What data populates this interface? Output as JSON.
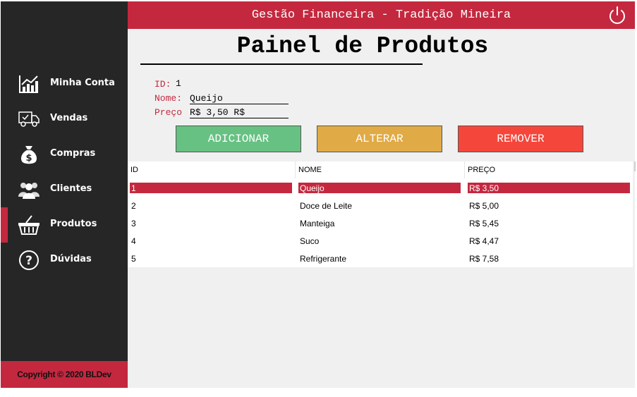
{
  "header": {
    "title": "Gestão Financeira - Tradição Mineira"
  },
  "sidebar": {
    "items": [
      {
        "label": "Minha Conta",
        "icon": "chart-icon"
      },
      {
        "label": "Vendas",
        "icon": "delivery-truck-icon"
      },
      {
        "label": "Compras",
        "icon": "money-bag-icon"
      },
      {
        "label": "Clientes",
        "icon": "people-icon"
      },
      {
        "label": "Produtos",
        "icon": "basket-icon"
      },
      {
        "label": "Dúvidas",
        "icon": "question-icon"
      }
    ],
    "active_item": "Produtos",
    "copyright": "Copyright © 2020 BLDev"
  },
  "main": {
    "title": "Painel de Produtos",
    "form": {
      "id_label": "ID:",
      "id_value": "1",
      "name_label": "Nome:",
      "name_value": "Queijo",
      "price_label": "Preço",
      "price_value": "R$ 3,50 R$"
    },
    "buttons": {
      "add": "ADICIONAR",
      "alter": "ALTERAR",
      "remove": "REMOVER"
    },
    "table": {
      "columns": [
        "ID",
        "NOME",
        "PREÇO"
      ],
      "rows": [
        {
          "id": "1",
          "name": "Queijo",
          "price": "R$ 3,50"
        },
        {
          "id": "2",
          "name": "Doce de Leite",
          "price": "R$ 5,00"
        },
        {
          "id": "3",
          "name": "Manteiga",
          "price": "R$ 5,45"
        },
        {
          "id": "4",
          "name": "Suco",
          "price": "R$ 4,47"
        },
        {
          "id": "5",
          "name": "Refrigerante",
          "price": "R$ 7,58"
        }
      ],
      "selected_row": 1
    }
  },
  "colors": {
    "accent": "#c4283f",
    "sidebar_bg": "#262626",
    "add": "#67c183",
    "alter": "#e0aa46",
    "remove": "#f5463c"
  }
}
